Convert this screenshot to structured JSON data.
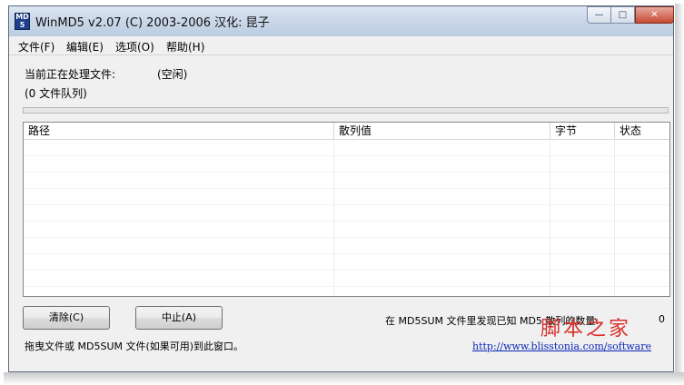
{
  "window": {
    "title": "WinMD5 v2.07 (C) 2003-2006 汉化: 昆子",
    "icon_text_top": "MD",
    "icon_text_bottom": "5",
    "controls": {
      "minimize": "—",
      "maximize": "□",
      "close": "✕"
    }
  },
  "menu": {
    "items": [
      {
        "label": "文件(F)"
      },
      {
        "label": "编辑(E)"
      },
      {
        "label": "选项(O)"
      },
      {
        "label": "帮助(H)"
      }
    ]
  },
  "status": {
    "current_file_label": "当前正在处理文件:",
    "current_file_value": "(空闲)",
    "queue_text": "(0 文件队列)"
  },
  "progress": {
    "fraction": 0.0,
    "accent": "#37b44a"
  },
  "table": {
    "columns": [
      "路径",
      "散列值",
      "字节",
      "状态"
    ],
    "rows": []
  },
  "buttons": {
    "clear": "清除(C)",
    "stop": "中止(A)"
  },
  "footer": {
    "found_label": "在 MD5SUM 文件里发现已知 MD5 散列的数量:",
    "found_count": "0",
    "hint": "拖曳文件或 MD5SUM 文件(如果可用)到此窗口。",
    "link": "http://www.blisstonia.com/software"
  },
  "watermark": "脚本之家"
}
